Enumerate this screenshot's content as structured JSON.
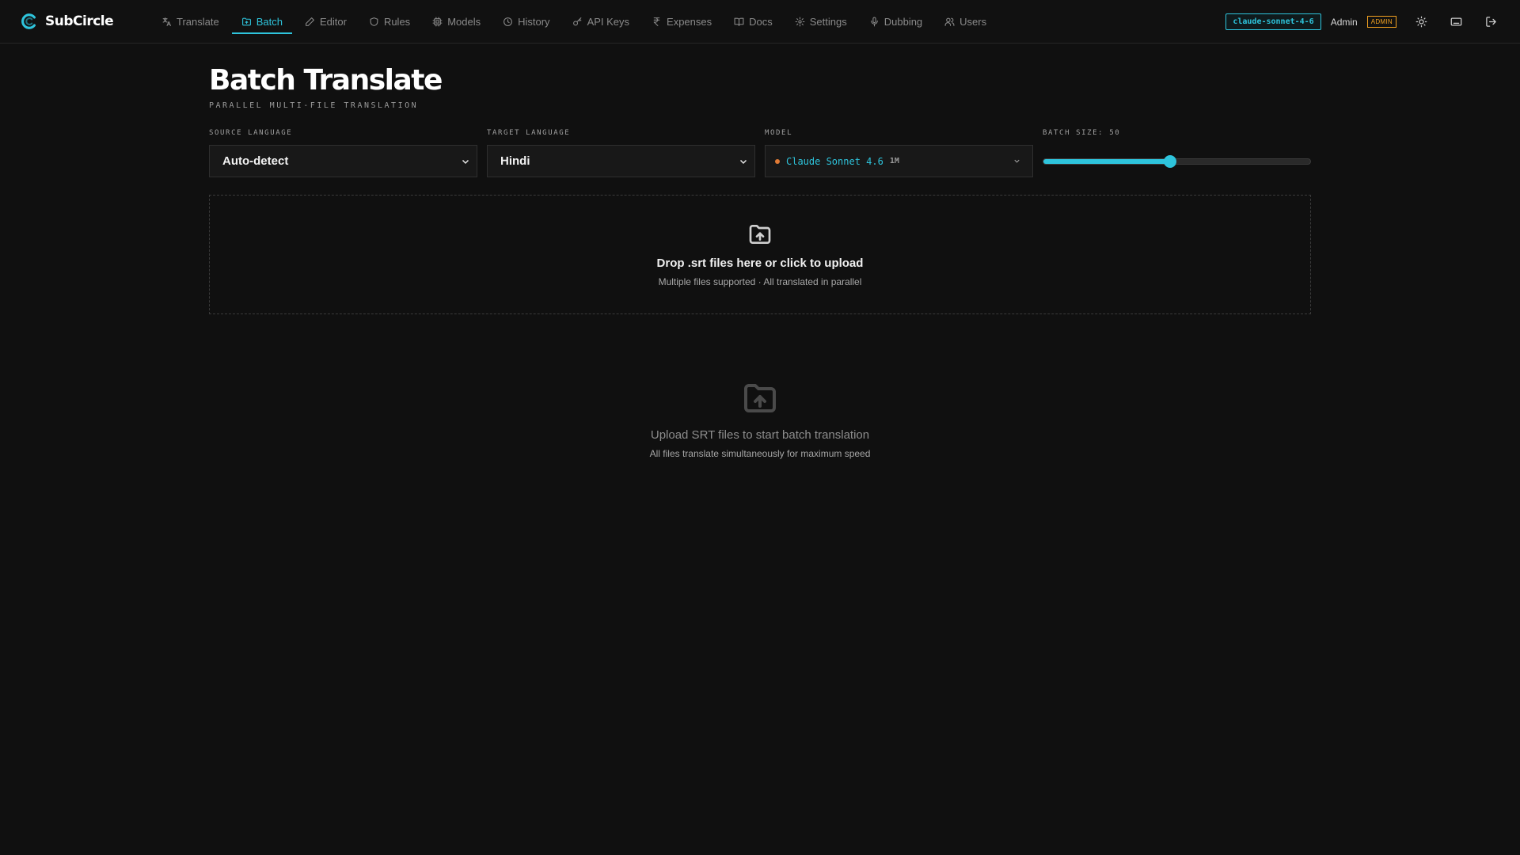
{
  "brand": {
    "name": "SubCircle",
    "logo_icon": "subcircle-logo-icon",
    "accent": "#2ec4dc"
  },
  "nav": {
    "items": [
      {
        "label": "Translate",
        "icon": "translate-icon",
        "active": false
      },
      {
        "label": "Batch",
        "icon": "folder-icon",
        "active": true
      },
      {
        "label": "Editor",
        "icon": "pencil-icon",
        "active": false
      },
      {
        "label": "Rules",
        "icon": "shield-icon",
        "active": false
      },
      {
        "label": "Models",
        "icon": "cpu-icon",
        "active": false
      },
      {
        "label": "History",
        "icon": "clock-icon",
        "active": false
      },
      {
        "label": "API Keys",
        "icon": "key-icon",
        "active": false
      },
      {
        "label": "Expenses",
        "icon": "rupee-icon",
        "active": false
      },
      {
        "label": "Docs",
        "icon": "book-icon",
        "active": false
      },
      {
        "label": "Settings",
        "icon": "gear-icon",
        "active": false
      },
      {
        "label": "Dubbing",
        "icon": "mic-icon",
        "active": false
      },
      {
        "label": "Users",
        "icon": "users-icon",
        "active": false
      }
    ]
  },
  "header": {
    "model_chip": "claude-sonnet-4-6",
    "user_name": "Admin",
    "role_badge": "ADMIN",
    "badge_color": "#f0a020",
    "actions": [
      "sun-icon",
      "keyboard-icon",
      "logout-icon"
    ]
  },
  "page": {
    "title": "Batch Translate",
    "subtitle": "PARALLEL MULTI-FILE TRANSLATION"
  },
  "controls": {
    "source_label": "SOURCE LANGUAGE",
    "source_value": "Auto-detect",
    "target_label": "TARGET LANGUAGE",
    "target_value": "Hindi",
    "model_label": "MODEL",
    "model_value": "Claude Sonnet 4.6",
    "model_context": "1M",
    "model_dot_color": "#e07a35",
    "batch_label": "BATCH SIZE: 50",
    "batch_fraction": 0.475
  },
  "dropzone": {
    "icon": "folder-upload-icon",
    "title": "Drop .srt files here or click to upload",
    "subtitle": "Multiple files supported · All translated in parallel"
  },
  "empty_state": {
    "icon": "folder-upload-icon",
    "title": "Upload SRT files to start batch translation",
    "subtitle": "All files translate simultaneously for maximum speed"
  }
}
